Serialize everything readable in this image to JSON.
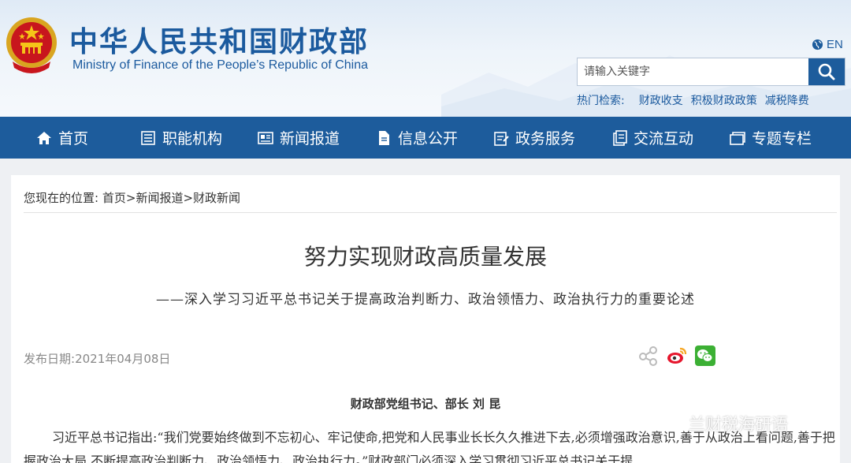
{
  "header": {
    "title_cn": "中华人民共和国财政部",
    "title_en": "Ministry of Finance of the People’s Republic of China",
    "lang": "EN",
    "search": {
      "placeholder": "请输入关键字"
    },
    "hot_search": {
      "label": "热门检索:",
      "items": [
        "财政收支",
        "积极财政政策",
        "减税降费"
      ]
    },
    "icons": [
      "emblem-icon",
      "globe-icon",
      "search-icon"
    ]
  },
  "nav": {
    "items": [
      {
        "label": "首页",
        "icon": "home-icon"
      },
      {
        "label": "职能机构",
        "icon": "list-icon"
      },
      {
        "label": "新闻报道",
        "icon": "news-icon"
      },
      {
        "label": "信息公开",
        "icon": "document-icon"
      },
      {
        "label": "政务服务",
        "icon": "service-icon"
      },
      {
        "label": "交流互动",
        "icon": "interact-icon"
      },
      {
        "label": "专题专栏",
        "icon": "topic-icon"
      }
    ]
  },
  "breadcrumb": {
    "prefix": "您现在的位置:",
    "items": [
      "首页",
      ">",
      "新闻报道",
      ">",
      "财政新闻"
    ]
  },
  "article": {
    "title": "努力实现财政高质量发展",
    "subtitle": "——深入学习习近平总书记关于提高政治判断力、政治领悟力、政治执行力的重要论述",
    "date_label": "发布日期:",
    "date": "2021年04月08日",
    "share_icons": [
      "share-icon",
      "weibo-icon",
      "wechat-icon"
    ],
    "author": "财政部党组书记、部长  刘  昆",
    "body": "习近平总书记指出:“我们党要始终做到不忘初心、牢记使命,把党和人民事业长长久久推进下去,必须增强政治意识,善于从政治上看问题,善于把握政治大局,不断提高政治判断力、政治领悟力、政治执行力。”财政部门必须深入学习贯彻习近平总书记关于提"
  },
  "watermark": "兰财税海研语",
  "colors": {
    "brand": "#1d5c9c",
    "title": "#1b5a9e"
  }
}
